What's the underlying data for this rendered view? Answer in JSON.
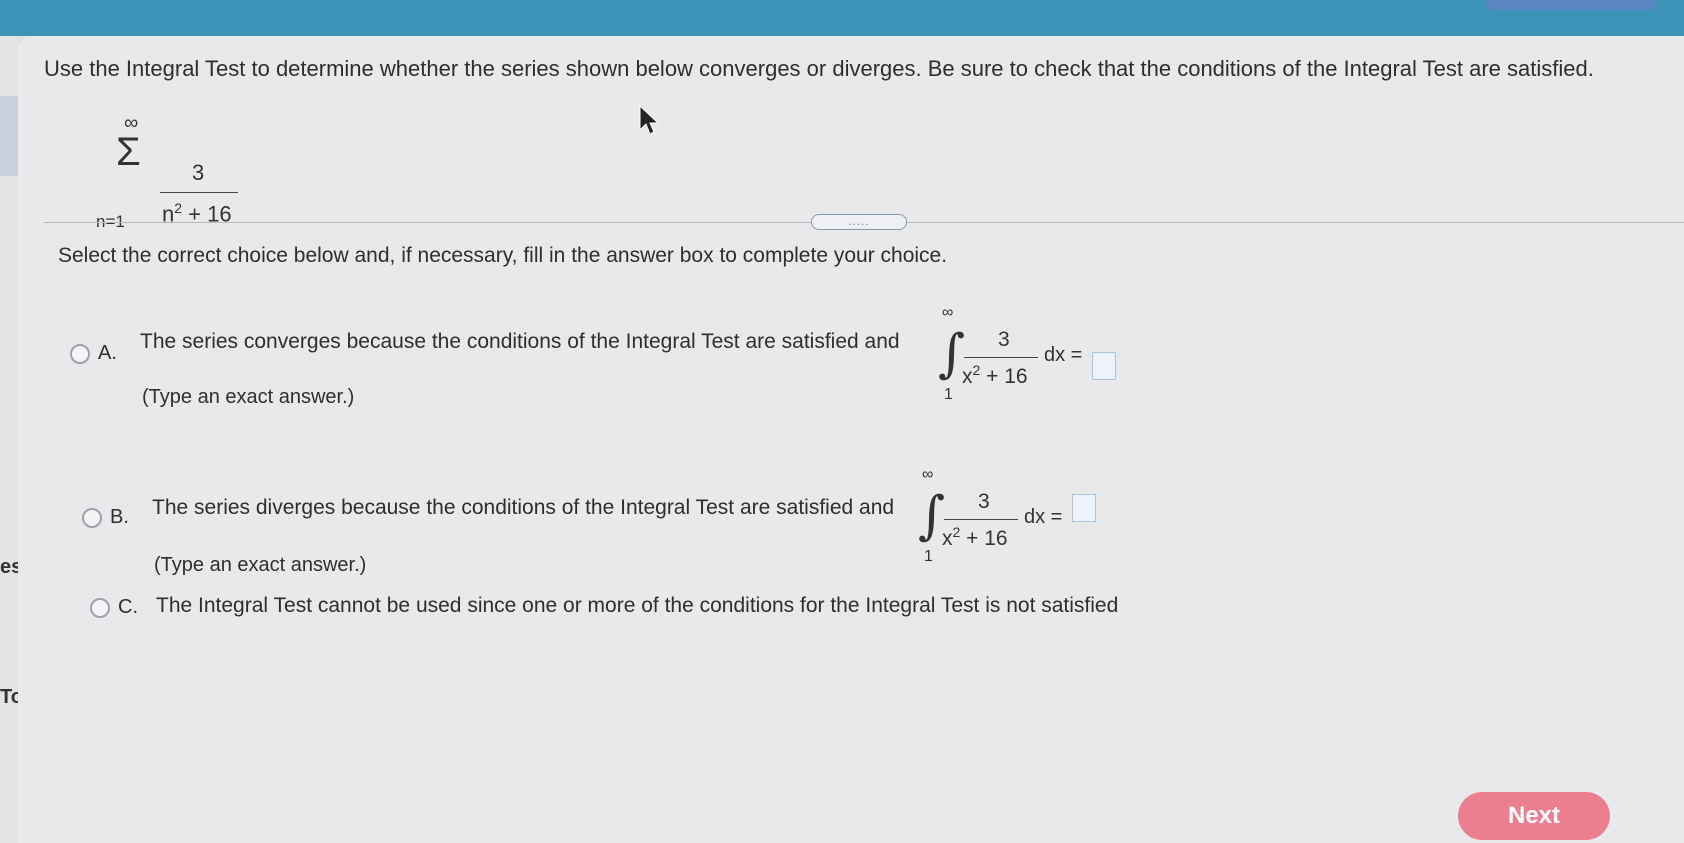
{
  "question": {
    "text": "Use the Integral Test to determine whether the series shown below converges or diverges. Be sure to check that the conditions of the Integral Test are satisfied."
  },
  "series": {
    "upper": "∞",
    "sigma": "Σ",
    "lower": "n=1",
    "numerator": "3",
    "denominator_base": "n",
    "denominator_exp": "2",
    "denominator_rest": " + 16"
  },
  "divider_handle": ".....",
  "instruction": "Select the correct choice below and, if necessary, fill in the answer box to complete your choice.",
  "options": [
    {
      "letter": "A.",
      "text": "The series converges because the conditions of the Integral Test are satisfied and",
      "hint": "(Type an exact answer.)",
      "integral": {
        "upper": "∞",
        "lower": "1",
        "numerator": "3",
        "den_base": "x",
        "den_exp": "2",
        "den_rest": " + 16",
        "dx": "dx ="
      }
    },
    {
      "letter": "B.",
      "text": "The series diverges because the conditions of the Integral Test are satisfied and",
      "hint": "(Type an exact answer.)",
      "integral": {
        "upper": "∞",
        "lower": "1",
        "numerator": "3",
        "den_base": "x",
        "den_exp": "2",
        "den_rest": " + 16",
        "dx": "dx ="
      }
    },
    {
      "letter": "C.",
      "text": "The Integral Test cannot be used since one or more of the conditions for the Integral Test is not satisfied"
    }
  ],
  "left_rail": {
    "label_1": "es",
    "label_2": "Tools"
  },
  "next_button": "Next"
}
